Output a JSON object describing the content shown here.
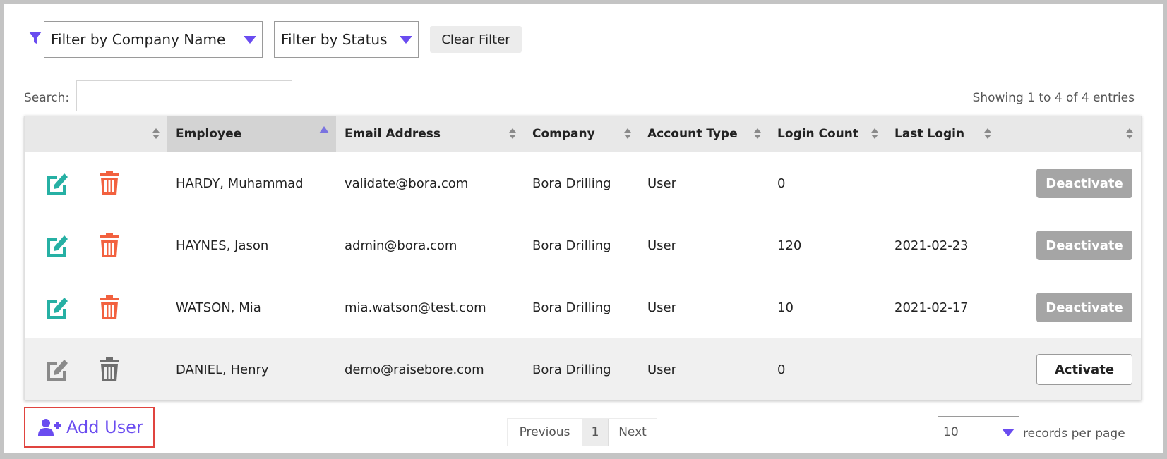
{
  "filters": {
    "company_placeholder": "Filter by Company Name",
    "status_placeholder": "Filter by Status",
    "clear_label": "Clear Filter"
  },
  "search": {
    "label": "Search:",
    "value": ""
  },
  "info": "Showing 1 to 4 of 4 entries",
  "columns": [
    "",
    "",
    "Employee",
    "Email Address",
    "Company",
    "Account Type",
    "Login Count",
    "Last Login",
    ""
  ],
  "rows": [
    {
      "employee": "HARDY, Muhammad",
      "email": "validate@bora.com",
      "company": "Bora Drilling",
      "account_type": "User",
      "login_count": "0",
      "last_login": "",
      "action": "Deactivate",
      "active": true
    },
    {
      "employee": "HAYNES, Jason",
      "email": "admin@bora.com",
      "company": "Bora Drilling",
      "account_type": "User",
      "login_count": "120",
      "last_login": "2021-02-23",
      "action": "Deactivate",
      "active": true
    },
    {
      "employee": "WATSON, Mia",
      "email": "mia.watson@test.com",
      "company": "Bora Drilling",
      "account_type": "User",
      "login_count": "10",
      "last_login": "2021-02-17",
      "action": "Deactivate",
      "active": true
    },
    {
      "employee": "DANIEL, Henry",
      "email": "demo@raisebore.com",
      "company": "Bora Drilling",
      "account_type": "User",
      "login_count": "0",
      "last_login": "",
      "action": "Activate",
      "active": false
    }
  ],
  "footer": {
    "add_user_label": "Add User",
    "pagination": {
      "previous": "Previous",
      "current": "1",
      "next": "Next"
    },
    "page_size": "10",
    "page_size_label": "records per page"
  },
  "colors": {
    "accent": "#6a4cf0",
    "edit_active": "#26b0a4",
    "delete_active": "#f2613f",
    "icon_inactive": "#7a7a7a",
    "highlight_border": "#e0443f"
  },
  "icons": {
    "filter": "filter-icon",
    "edit": "edit-icon",
    "delete": "trash-icon",
    "add_user": "user-plus-icon"
  }
}
